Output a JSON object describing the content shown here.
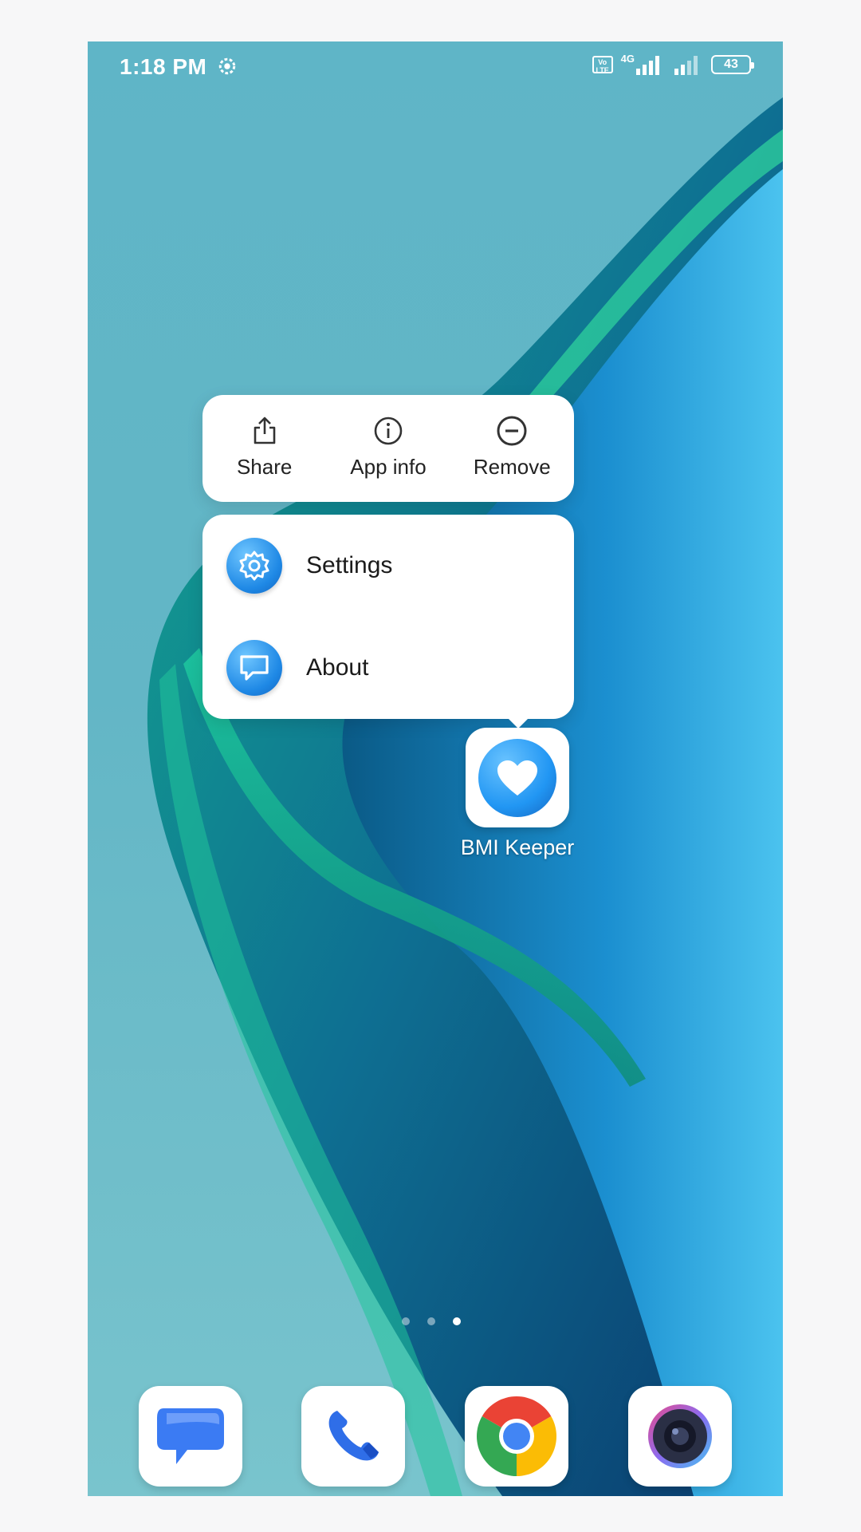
{
  "status_bar": {
    "time": "1:18 PM",
    "network": "4G",
    "battery": "43"
  },
  "context_menu": {
    "actions": [
      {
        "label": "Share",
        "icon": "share-icon"
      },
      {
        "label": "App info",
        "icon": "info-icon"
      },
      {
        "label": "Remove",
        "icon": "remove-icon"
      }
    ],
    "shortcuts": [
      {
        "label": "Settings",
        "icon": "gear-icon"
      },
      {
        "label": "About",
        "icon": "chat-bubble-icon"
      }
    ]
  },
  "app": {
    "name": "BMI Keeper",
    "icon": "heart-icon"
  },
  "page_indicator": {
    "count": 3,
    "active": 3
  },
  "dock": [
    {
      "app": "messages",
      "icon": "messages-icon"
    },
    {
      "app": "phone",
      "icon": "phone-icon"
    },
    {
      "app": "chrome",
      "icon": "chrome-icon"
    },
    {
      "app": "camera",
      "icon": "camera-icon"
    }
  ],
  "colors": {
    "wallpaper_base": "#5fb5c7",
    "accent_blue": "#1e88e5",
    "menu_bg": "#ffffff"
  }
}
